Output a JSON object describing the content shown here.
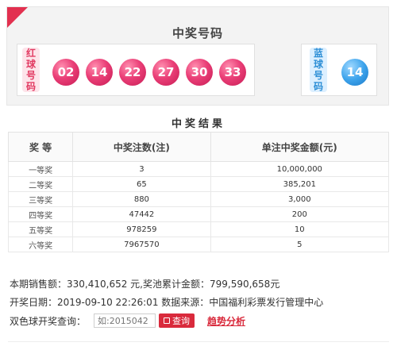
{
  "header": {
    "title": "中奖号码"
  },
  "red": {
    "label": [
      "红",
      "球",
      "号",
      "码"
    ],
    "balls": [
      "02",
      "14",
      "22",
      "27",
      "30",
      "33"
    ]
  },
  "blue": {
    "label": [
      "蓝",
      "球",
      "号",
      "码"
    ],
    "balls": [
      "14"
    ]
  },
  "results": {
    "title": "中奖结果",
    "headers": [
      "奖 等",
      "中奖注数(注)",
      "单注中奖金额(元)"
    ],
    "rows": [
      [
        "一等奖",
        "3",
        "10,000,000"
      ],
      [
        "二等奖",
        "65",
        "385,201"
      ],
      [
        "三等奖",
        "880",
        "3,000"
      ],
      [
        "四等奖",
        "47442",
        "200"
      ],
      [
        "五等奖",
        "978259",
        "10"
      ],
      [
        "六等奖",
        "7967570",
        "5"
      ]
    ]
  },
  "info": {
    "sales": "本期销售额：330,410,652 元,奖池累计金额：799,590,658元",
    "draw": "开奖日期：2019-09-10  22:26:01  数据来源：中国福利彩票发行管理中心"
  },
  "query": {
    "label": "双色球开奖查询：",
    "placeholder": "如:2015042",
    "button": "查询",
    "trend": "趋势分析"
  },
  "colors": {
    "accent": "#d92a3c",
    "red_ball": "#ea3f77",
    "blue_ball": "#3ea4ec"
  }
}
